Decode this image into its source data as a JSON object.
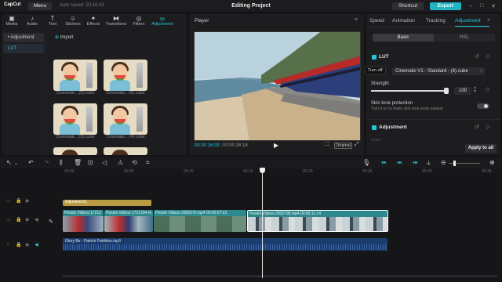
{
  "app": {
    "logo": "CapCut",
    "menu": "Menu",
    "autosave": "Auto saved: 20:16:43",
    "title": "Editing Project",
    "shortcut": "Shortcut",
    "export": "Export"
  },
  "media_tabs": [
    {
      "label": "Media",
      "icon": "media-icon"
    },
    {
      "label": "Audio",
      "icon": "audio-icon"
    },
    {
      "label": "Text",
      "icon": "text-icon"
    },
    {
      "label": "Stickers",
      "icon": "stickers-icon"
    },
    {
      "label": "Effects",
      "icon": "effects-icon"
    },
    {
      "label": "Transitions",
      "icon": "transitions-icon"
    },
    {
      "label": "Filters",
      "icon": "filters-icon"
    },
    {
      "label": "Adjustment",
      "icon": "adjustment-icon"
    }
  ],
  "media_side": [
    "• Adjustment",
    "LUT"
  ],
  "import_label": "Import",
  "luts": [
    "Cinematic...(5).cube",
    "Cinematic...(6).cube",
    "Cinematic...(3).cube",
    "Cinematic...(4).cube"
  ],
  "player": {
    "header": "Player",
    "current": "00:00:16:09",
    "total": "00:00:26:18",
    "original": "Original"
  },
  "props_tabs": [
    "Speed",
    "Animation",
    "Tracking",
    "Adjustment"
  ],
  "props": {
    "seg_basic": "Basic",
    "seg_hsl": "HSL",
    "lut_label": "LUT",
    "tooltip": "Turn off",
    "lut_value": "Cinematic V1 - Standard - (6).cube",
    "strength_label": "Strength",
    "strength_value": "100",
    "strength_fraction": 1.0,
    "skin_label": "Skin tone protection",
    "skin_hint": "Turn it on to make skin tone more natural",
    "adjustment_label": "Adjustment",
    "color_label": "Color",
    "apply_all": "Apply to all"
  },
  "ruler": [
    "00:00",
    "00:05",
    "00:10",
    "00:15",
    "00:20",
    "00:25",
    "00:30",
    "00:35"
  ],
  "tracks": {
    "adjustment": "Adjustment1",
    "clips": [
      {
        "name": "Pexels Videos 17212",
        "kind": "train"
      },
      {
        "name": "Pexels Videos 1721294.m",
        "kind": "train"
      },
      {
        "name": "Pexels Videos 2355570.mp4  00:00:07:23",
        "kind": "landscape"
      },
      {
        "name": "Pexels Videos 2000798.mp4  00:00:11:14",
        "kind": "landscape"
      }
    ],
    "audio": "Glory Be - Patrick Patrikios.mp3"
  }
}
